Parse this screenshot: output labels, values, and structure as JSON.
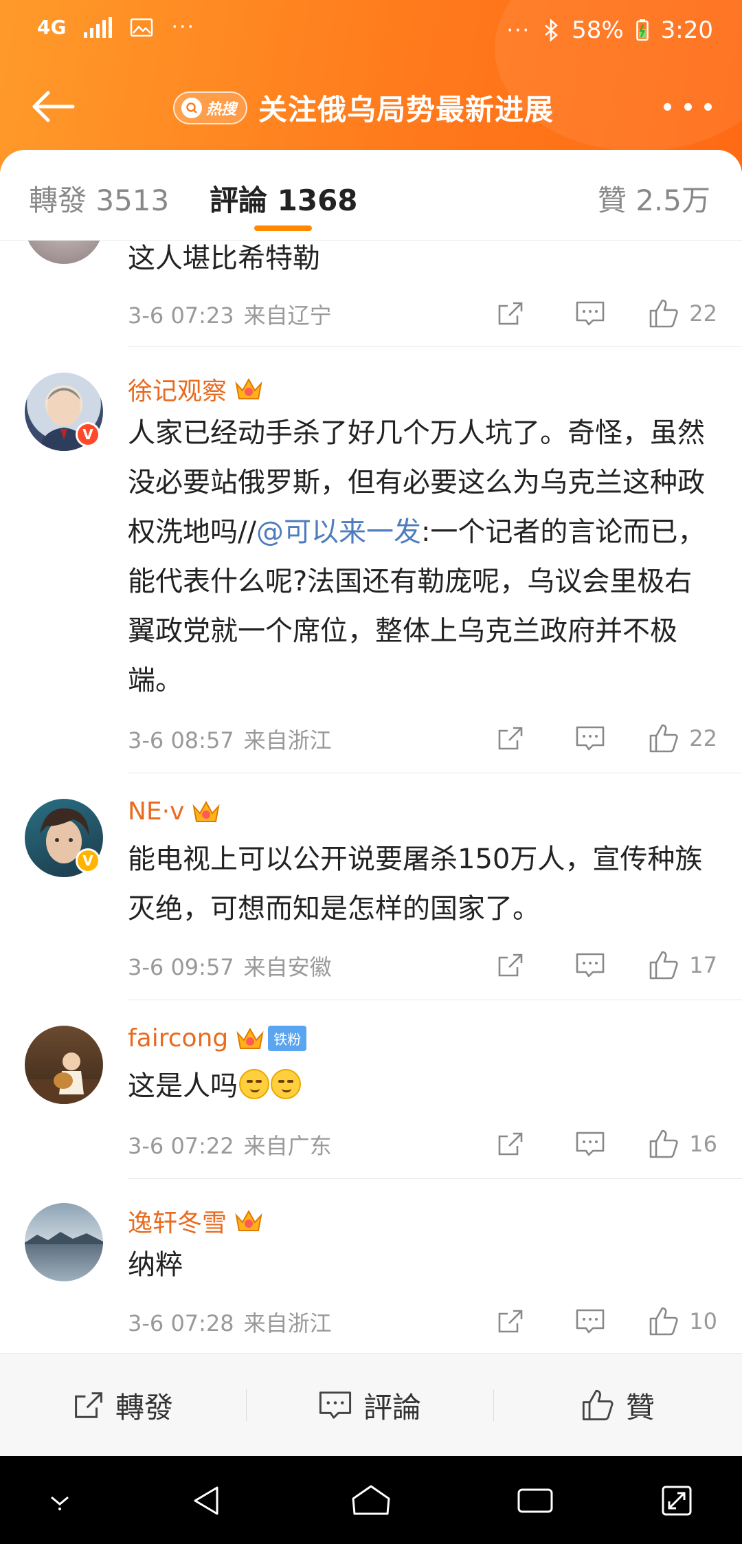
{
  "status_bar": {
    "network": "4G",
    "battery": "58%",
    "time": "3:20",
    "overflow_left": "···",
    "overflow_right": "···"
  },
  "header": {
    "hot_tag": "热搜",
    "title": "关注俄乌局势最新进展"
  },
  "tabs": {
    "repost": "轉發 3513",
    "comment": "評論 1368",
    "like": "贊 2.5万"
  },
  "comments": [
    {
      "username": "",
      "text": "这人堪比希特勒",
      "time": "3-6 07:23",
      "location": "来自辽宁",
      "likes": "22"
    },
    {
      "username": "徐记观察",
      "text_before": "人家已经动手杀了好几个万人坑了。奇怪，虽然没必要站俄罗斯，但有必要这么为乌克兰这种政权洗地吗//",
      "mention": "@可以来一发",
      "text_after": ":一个记者的言论而已，能代表什么呢?法国还有勒庞呢，乌议会里极右翼政党就一个席位，整体上乌克兰政府并不极端。",
      "time": "3-6 08:57",
      "location": "来自浙江",
      "likes": "22"
    },
    {
      "username": "NE·v",
      "text": "能电视上可以公开说要屠杀150万人，宣传种族灭绝，可想而知是怎样的国家了。",
      "time": "3-6 09:57",
      "location": "来自安徽",
      "likes": "17"
    },
    {
      "username": "faircong",
      "fan_badge": "铁粉",
      "text": "这是人吗",
      "time": "3-6 07:22",
      "location": "来自广东",
      "likes": "16"
    },
    {
      "username": "逸轩冬雪",
      "text": "纳粹",
      "time": "3-6 07:28",
      "location": "来自浙江",
      "likes": "10"
    }
  ],
  "bottom_bar": {
    "repost": "轉發",
    "comment": "評論",
    "like": "贊"
  },
  "icons": {
    "back": "arrow-left-icon",
    "more": "more-dots-icon",
    "share": "share-icon",
    "comment": "comment-icon",
    "like": "thumbs-up-icon"
  },
  "colors": {
    "header_orange": "#ff7a1c",
    "username_orange": "#e86b1f",
    "mention_blue": "#4e7cbd",
    "tab_underline": "#ff8a00"
  }
}
